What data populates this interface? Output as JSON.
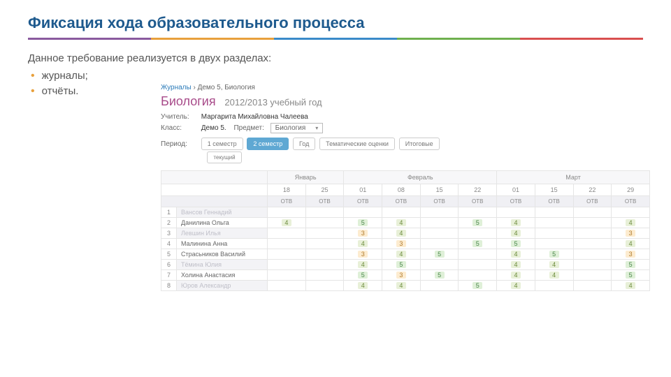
{
  "slide": {
    "title": "Фиксация хода образовательного процесса",
    "intro": "Данное требование реализуется в двух разделах:",
    "bullets": [
      "журналы;",
      "отчёты."
    ]
  },
  "journal": {
    "crumb_link": "Журналы",
    "crumb_rest": "Демо 5, Биология",
    "subject": "Биология",
    "year": "2012/2013 учебный год",
    "teacher_lbl": "Учитель:",
    "teacher": "Маргарита Михайловна Чалеева",
    "class_lbl": "Класс:",
    "class": "Демо 5.",
    "subj_lbl": "Предмет:",
    "subj_sel": "Биология",
    "period_lbl": "Период:",
    "tabs": {
      "t1": "1 семестр",
      "t2": "2 семестр",
      "t3": "Год",
      "t4": "Тематические оценки",
      "t5": "Итоговые",
      "sub": "текущий"
    },
    "months": [
      "Январь",
      "Февраль",
      "Март"
    ],
    "days": [
      "18",
      "25",
      "01",
      "08",
      "15",
      "22",
      "01",
      "15",
      "22",
      "29"
    ],
    "type": "ОТВ",
    "students": [
      {
        "n": "1",
        "name": "Вансов Геннадий",
        "odd": true,
        "grades": [
          "",
          "",
          "",
          "",
          "",
          "",
          "",
          "",
          "",
          ""
        ]
      },
      {
        "n": "2",
        "name": "Данилина Ольга",
        "odd": false,
        "grades": [
          "4",
          "",
          "5",
          "4",
          "",
          "5",
          "4",
          "",
          "",
          "4"
        ]
      },
      {
        "n": "3",
        "name": "Левшин Илья",
        "odd": true,
        "grades": [
          "",
          "",
          "3",
          "4",
          "",
          "",
          "4",
          "",
          "",
          "3"
        ]
      },
      {
        "n": "4",
        "name": "Малинина Анна",
        "odd": false,
        "grades": [
          "",
          "",
          "4",
          "3",
          "",
          "5",
          "5",
          "",
          "",
          "4"
        ]
      },
      {
        "n": "5",
        "name": "Страсьников Василий",
        "odd": false,
        "grades": [
          "",
          "",
          "3",
          "4",
          "5",
          "",
          "4",
          "5",
          "",
          "3"
        ]
      },
      {
        "n": "6",
        "name": "Тёмина Юлия",
        "odd": true,
        "grades": [
          "",
          "",
          "4",
          "5",
          "",
          "",
          "4",
          "4",
          "",
          "5"
        ]
      },
      {
        "n": "7",
        "name": "Холина Анастасия",
        "odd": false,
        "grades": [
          "",
          "",
          "5",
          "3",
          "5",
          "",
          "4",
          "4",
          "",
          "5"
        ]
      },
      {
        "n": "8",
        "name": "Юров Александр",
        "odd": true,
        "grades": [
          "",
          "",
          "4",
          "4",
          "",
          "5",
          "4",
          "",
          "",
          "4"
        ]
      }
    ]
  }
}
